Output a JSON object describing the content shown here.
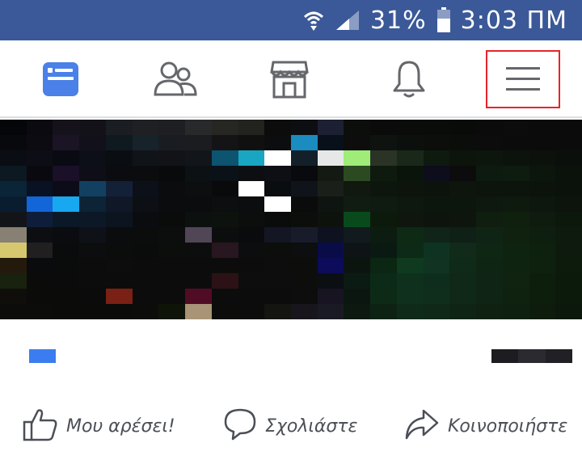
{
  "status_bar": {
    "battery_percent": "31%",
    "time": "3:03 ΠΜ",
    "icons": [
      "wifi-calling-icon",
      "signal-icon",
      "battery-icon"
    ],
    "background": "#3b5998"
  },
  "nav_bar": {
    "tabs": [
      {
        "icon": "news-feed-icon",
        "active": true
      },
      {
        "icon": "friends-icon",
        "active": false
      },
      {
        "icon": "marketplace-icon",
        "active": false
      },
      {
        "icon": "notifications-icon",
        "active": false
      },
      {
        "icon": "menu-icon",
        "active": false,
        "highlighted": true
      }
    ],
    "active_color": "#4a80e8",
    "inactive_color": "#65676b",
    "highlight_color": "#e8232a"
  },
  "post": {
    "like_reaction_color": "#3b7df0",
    "actions": {
      "like_label": "Μου αρέσει!",
      "comment_label": "Σχολιάστε",
      "share_label": "Κοινοποιήστε"
    }
  }
}
